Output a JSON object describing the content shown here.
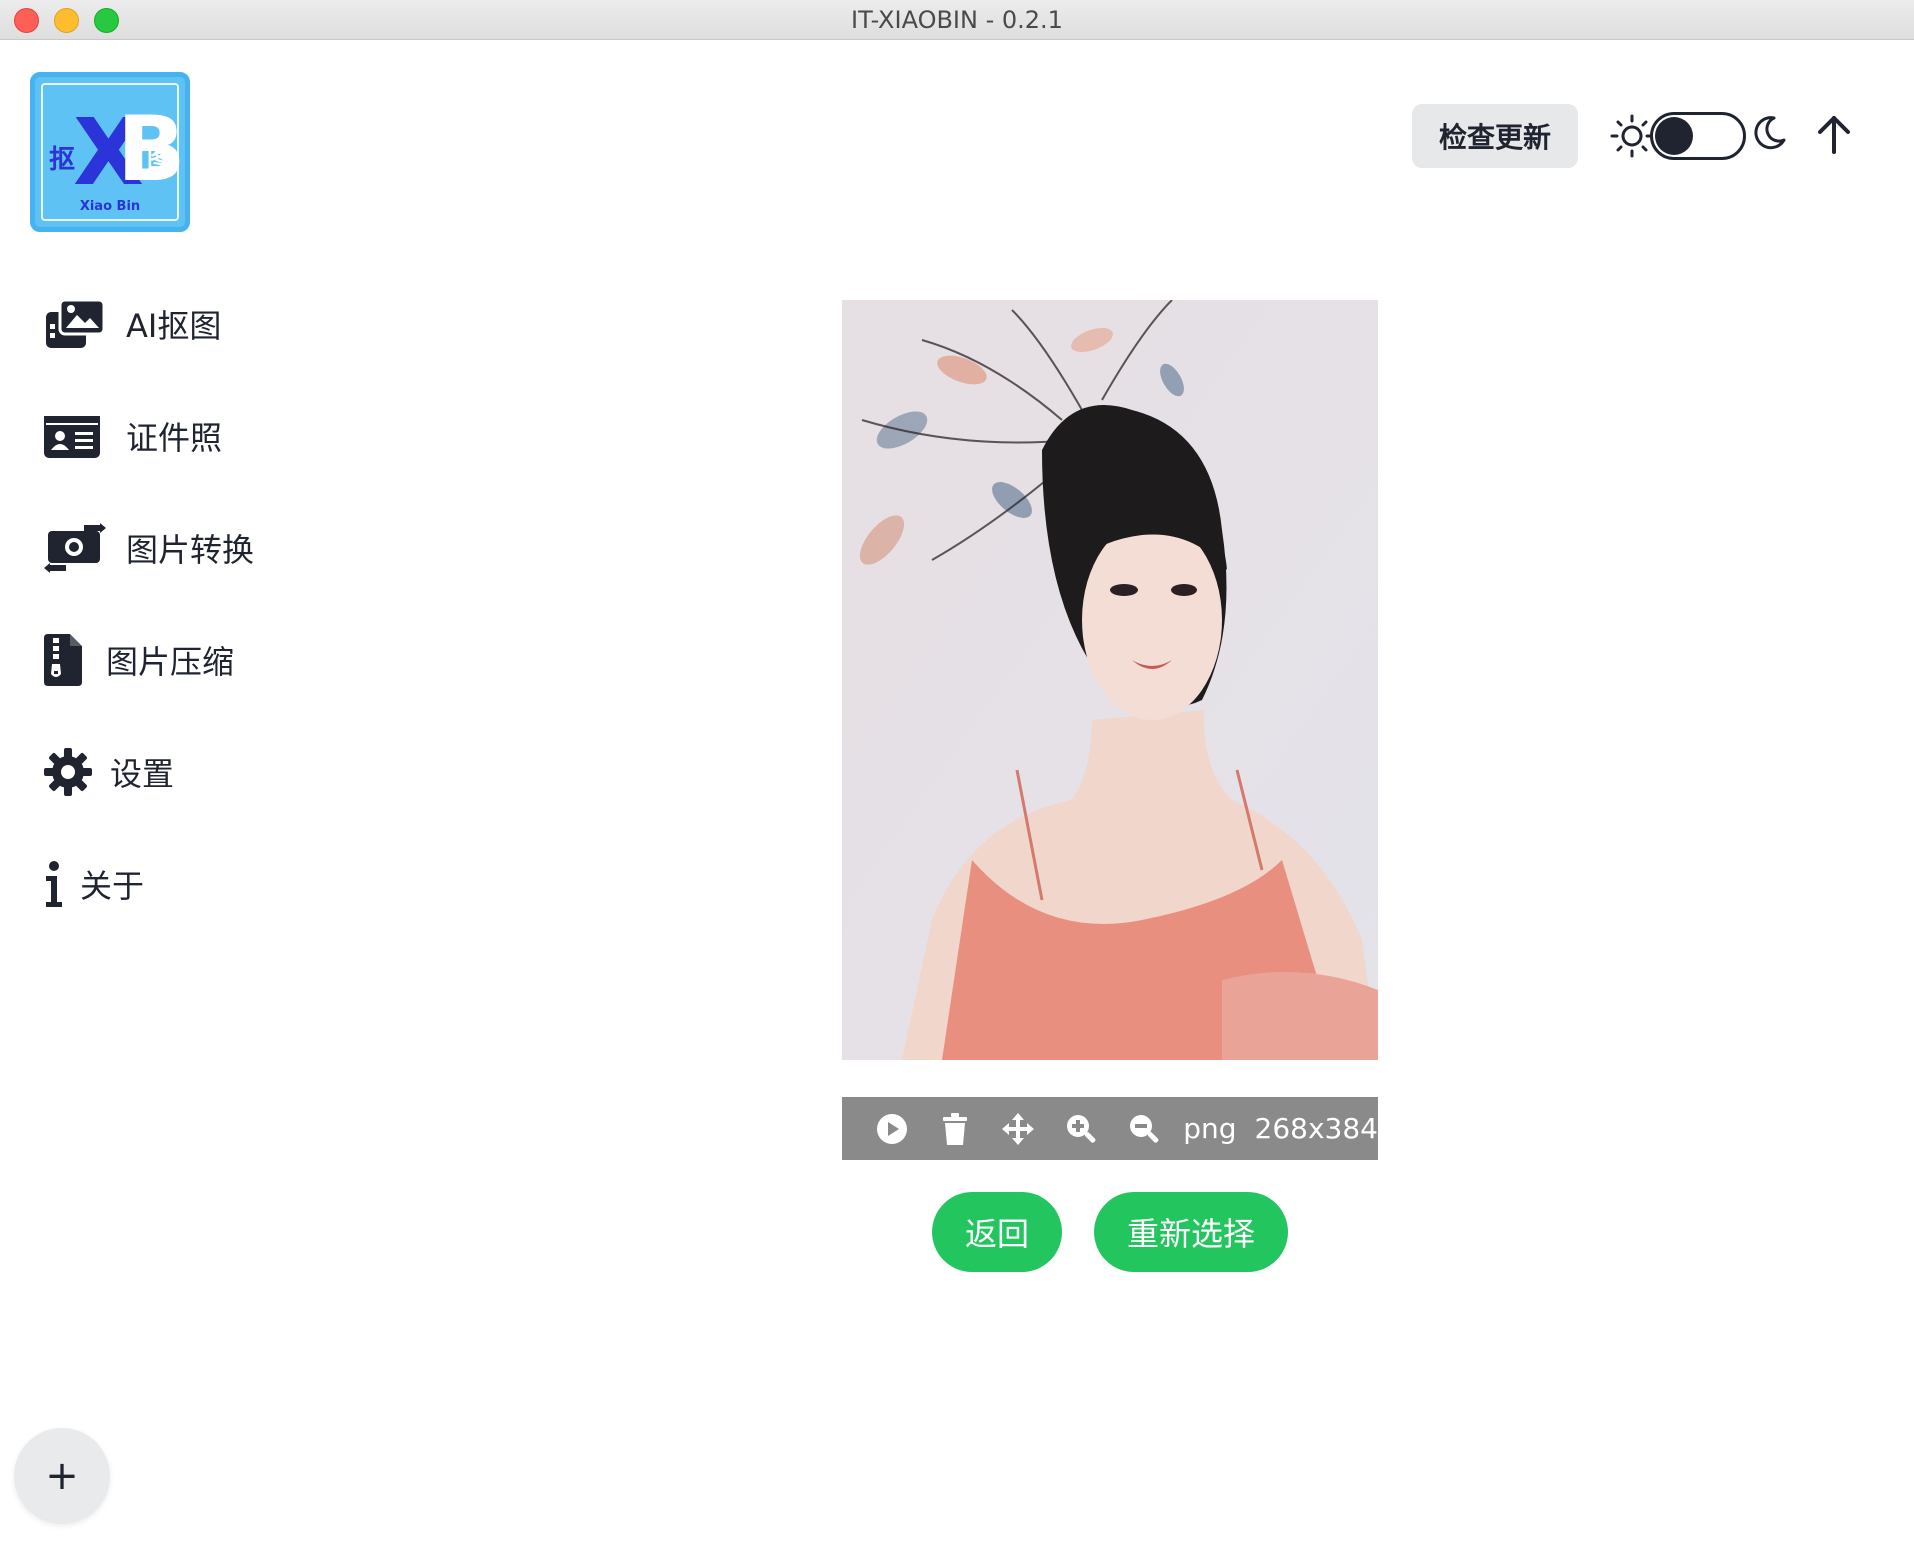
{
  "window": {
    "title": "IT-XIAOBIN - 0.2.1"
  },
  "logo": {
    "cn_left": "抠",
    "cn_right": "图",
    "x": "X",
    "b": "B",
    "subtitle": "Xiao Bin"
  },
  "header": {
    "check_update_label": "检查更新"
  },
  "sidebar": {
    "items": [
      {
        "label": "AI抠图",
        "icon": "images-icon"
      },
      {
        "label": "证件照",
        "icon": "id-card-icon"
      },
      {
        "label": "图片转换",
        "icon": "money-bill-transfer-icon"
      },
      {
        "label": "图片压缩",
        "icon": "file-zipper-icon"
      },
      {
        "label": "设置",
        "icon": "gear-icon"
      },
      {
        "label": "关于",
        "icon": "info-icon"
      }
    ]
  },
  "image": {
    "format": "png",
    "dimensions": "268x384"
  },
  "actions": {
    "back_label": "返回",
    "reselect_label": "重新选择"
  },
  "fab": {
    "label": "+"
  },
  "colors": {
    "accent_green": "#22c55e",
    "toolbar_gray": "#8a8a8a",
    "logo_blue": "#5ec3f4",
    "icon_dark": "#1f2430"
  }
}
